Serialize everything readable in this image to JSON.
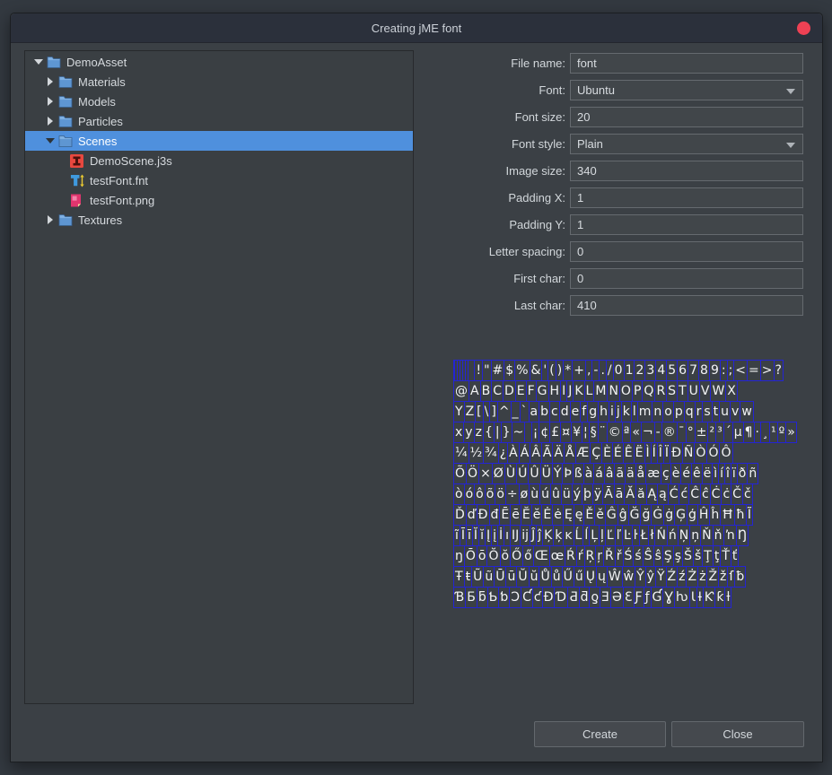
{
  "window": {
    "title": "Creating jME font"
  },
  "titlebar": {
    "close_icon": "red-circle"
  },
  "tree": {
    "items": [
      {
        "label": "DemoAsset",
        "level": 0,
        "icon": "folder",
        "expander": "expanded",
        "selected": false
      },
      {
        "label": "Materials",
        "level": 1,
        "icon": "folder",
        "expander": "collapsed",
        "selected": false
      },
      {
        "label": "Models",
        "level": 1,
        "icon": "folder",
        "expander": "collapsed",
        "selected": false
      },
      {
        "label": "Particles",
        "level": 1,
        "icon": "folder",
        "expander": "collapsed",
        "selected": false
      },
      {
        "label": "Scenes",
        "level": 1,
        "icon": "folder",
        "expander": "expanded",
        "selected": true
      },
      {
        "label": "DemoScene.j3s",
        "level": 2,
        "icon": "jme-scene",
        "expander": "none",
        "selected": false
      },
      {
        "label": "testFont.fnt",
        "level": 2,
        "icon": "font-file",
        "expander": "none",
        "selected": false
      },
      {
        "label": "testFont.png",
        "level": 2,
        "icon": "image-file",
        "expander": "none",
        "selected": false
      },
      {
        "label": "Textures",
        "level": 1,
        "icon": "folder",
        "expander": "collapsed",
        "selected": false
      }
    ]
  },
  "form": {
    "fields": [
      {
        "id": "file-name",
        "label": "File name:",
        "value": "font",
        "type": "text"
      },
      {
        "id": "font",
        "label": "Font:",
        "value": "Ubuntu",
        "type": "select"
      },
      {
        "id": "font-size",
        "label": "Font size:",
        "value": "20",
        "type": "text"
      },
      {
        "id": "font-style",
        "label": "Font style:",
        "value": "Plain",
        "type": "select"
      },
      {
        "id": "image-size",
        "label": "Image size:",
        "value": "340",
        "type": "text"
      },
      {
        "id": "padding-x",
        "label": "Padding X:",
        "value": "1",
        "type": "text"
      },
      {
        "id": "padding-y",
        "label": "Padding Y:",
        "value": "1",
        "type": "text"
      },
      {
        "id": "letter-spacing",
        "label": "Letter spacing:",
        "value": "0",
        "type": "text"
      },
      {
        "id": "first-char",
        "label": "First char:",
        "value": "0",
        "type": "text"
      },
      {
        "id": "last-char",
        "label": "Last char:",
        "value": "410",
        "type": "text"
      }
    ]
  },
  "preview": {
    "grid_color": "#2424d4",
    "rows": [
      " !\"#$%&'()*+,-./0123456789:;<=>?",
      "@ABCDEFGHIJKLMNOPQRSTUVWX",
      "YZ[\\]^_`abcdefghijklmnopqrstuvw",
      "xyz{|}~ ¡¢£¤¥¦§¨©ª«¬-®¯°±²³´µ¶·¸¹º»",
      "¼½¾¿ÀÁÂÃÄÅÆÇÈÉÊËÌÍÎÏÐÑÒÓÔ",
      "ÕÖ×ØÙÚÛÜÝÞßàáâãäåæçèéêëìíîïðñ",
      "òóôõö÷øùúûüýþÿĀāĂăĄąĆćĈĉĊċČč",
      "ĎďĐđĒēĔĕĖėĘęĚěĜĝĞğĠġĢģĤĥĦħĨ",
      "ĩĪīĬĭĮįİıĲĳĴĵĶķĸĹĺĻļĽľĿŀŁłŃńŅņŇňŉŊ",
      "ŋŌōŎŏŐőŒœŔŕŖŗŘřŚśŜŝŞşŠšŢţŤť",
      "ŦŧŨũŪūŬŭŮůŰűŲųŴŵŶŷŸŹźŻżŽžſƀ",
      "ƁƂƃƄƅƆƇƈƉƊƋƌƍƎƏƐƑƒƓƔƕƖƗƘƙƚ"
    ]
  },
  "buttons": {
    "create_label": "Create",
    "close_label": "Close"
  },
  "colors": {
    "selection": "#4f90dd",
    "titlebar": "#2b303b",
    "window_bg": "#3b4045",
    "close_button": "#ee4154",
    "grid_blue": "#2424d4",
    "folder_blue": "#5e96d2"
  }
}
